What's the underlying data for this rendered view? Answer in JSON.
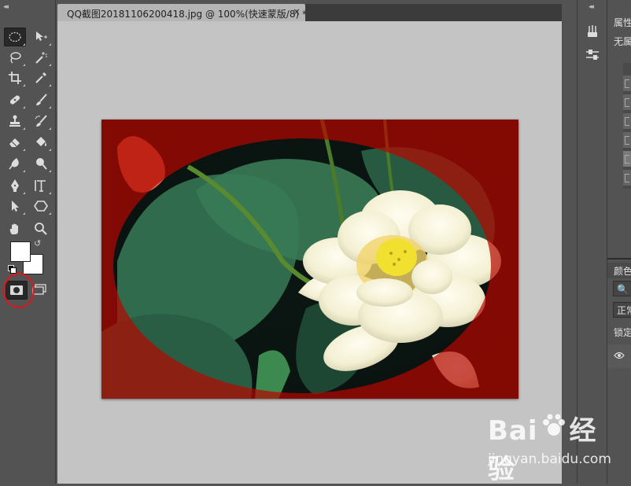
{
  "document": {
    "tab_title": "QQ截图20181106200418.jpg @ 100%(快速蒙版/8) *",
    "close": "×"
  },
  "toolbar": {
    "collapse": "◂◂",
    "tools": [
      {
        "name": "marquee-tool",
        "active": true
      },
      {
        "name": "move-tool"
      },
      {
        "name": "lasso-tool"
      },
      {
        "name": "magic-wand-tool"
      },
      {
        "name": "crop-tool"
      },
      {
        "name": "eyedropper-tool"
      },
      {
        "name": "healing-brush-tool"
      },
      {
        "name": "brush-tool"
      },
      {
        "name": "clone-stamp-tool"
      },
      {
        "name": "history-brush-tool"
      },
      {
        "name": "eraser-tool"
      },
      {
        "name": "paint-bucket-tool"
      },
      {
        "name": "blur-tool"
      },
      {
        "name": "dodge-tool"
      },
      {
        "name": "pen-tool"
      },
      {
        "name": "type-tool"
      },
      {
        "name": "path-selection-tool"
      },
      {
        "name": "shape-tool"
      },
      {
        "name": "hand-tool"
      },
      {
        "name": "zoom-tool"
      }
    ],
    "foreground_color": "#ffffff",
    "background_color": "#ffffff",
    "quick_mask_active": true,
    "annotation_color": "#e0141b"
  },
  "right_dock": {
    "collapse": "◂◂"
  },
  "panels": {
    "properties_tab": "属性",
    "properties_value": "无属",
    "color_tab": "颜色",
    "search_field": "🔍 类",
    "blend_mode": "正常",
    "lock_label": "锁定"
  },
  "watermark": {
    "logo_text_1": "Bai",
    "logo_text_2": "经验",
    "url": "jingyan.baidu.com"
  }
}
